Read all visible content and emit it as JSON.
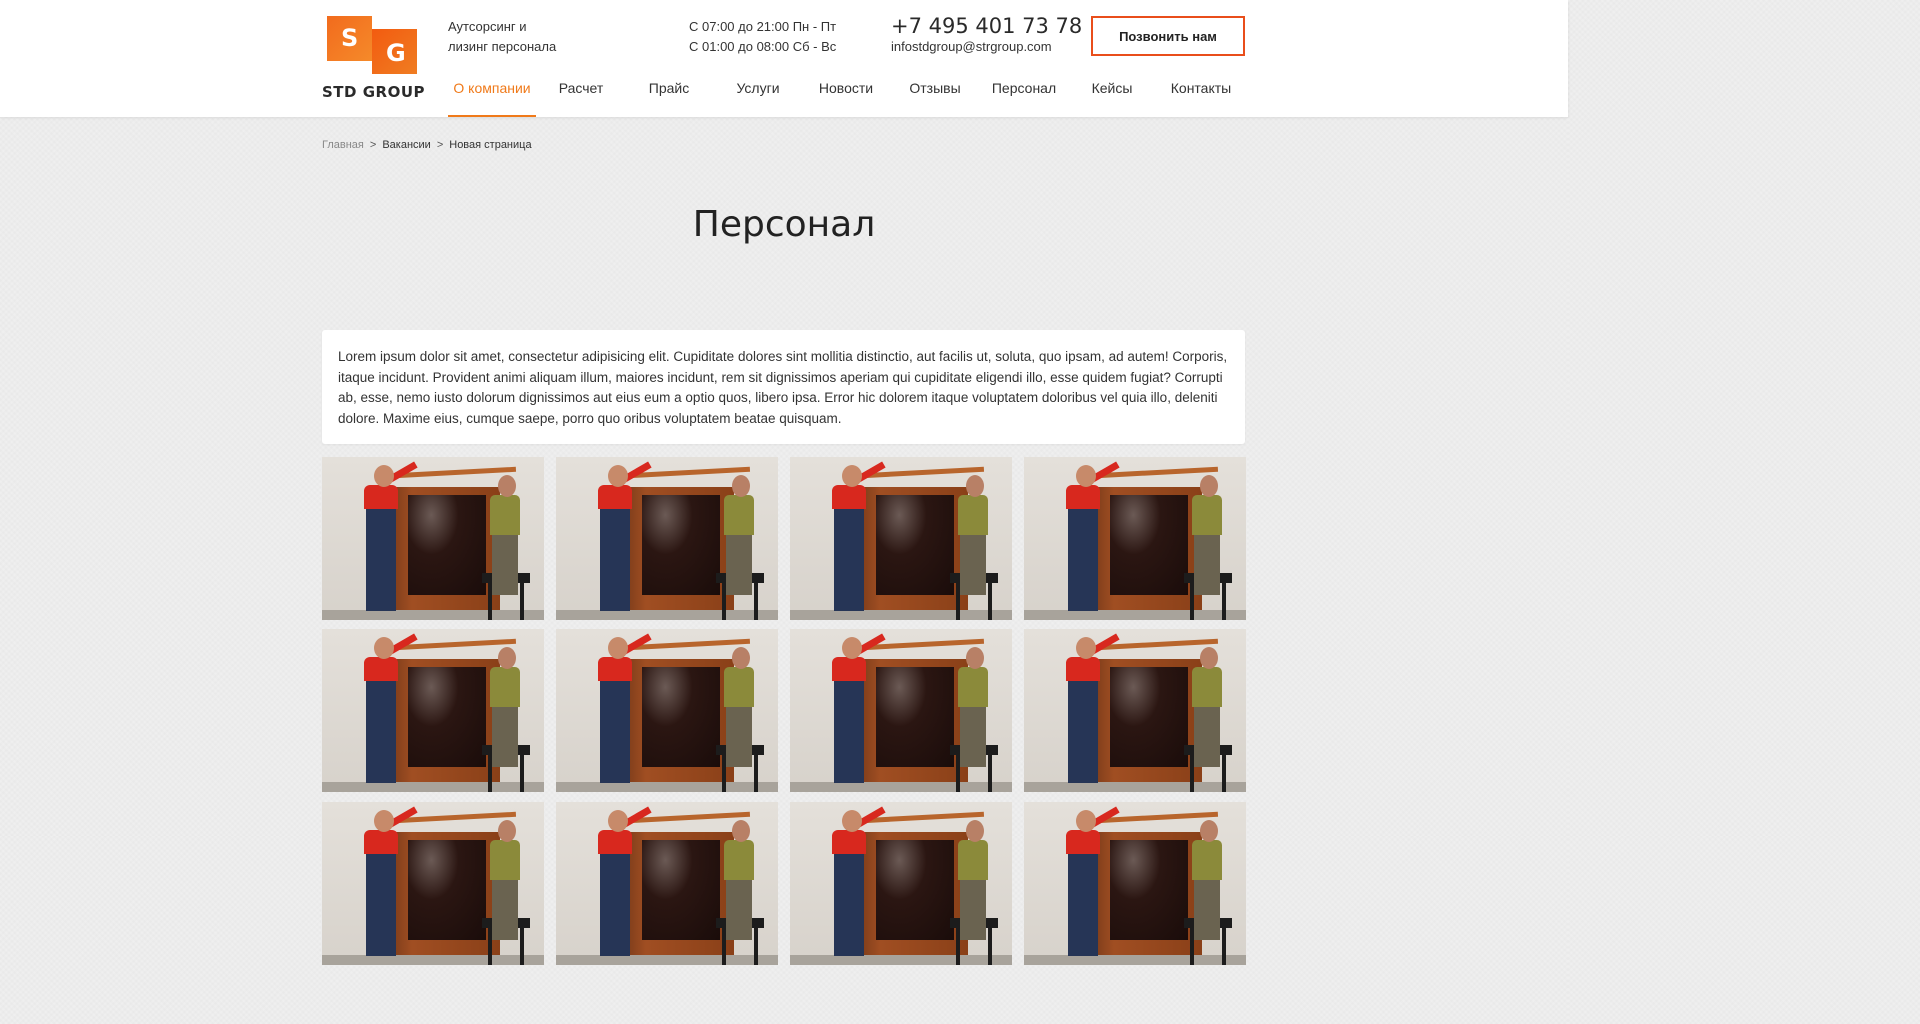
{
  "logo": {
    "letter1": "S",
    "letter2": "G",
    "name": "STD GROUP"
  },
  "tagline": {
    "line1": "Аутсорсинг и",
    "line2": "лизинг персонала"
  },
  "hours": {
    "line1": "С 07:00 до 21:00 Пн - Пт",
    "line2": "С 01:00 до 08:00 Сб - Вс"
  },
  "contact": {
    "phone": "+7 495 401 73 78",
    "email": "infostdgroup@strgroup.com"
  },
  "call_button": "Позвонить нам",
  "nav": {
    "items": [
      {
        "label": "О компании",
        "active": true
      },
      {
        "label": "Расчет",
        "active": false
      },
      {
        "label": "Прайс",
        "active": false
      },
      {
        "label": "Услуги",
        "active": false
      },
      {
        "label": "Новости",
        "active": false
      },
      {
        "label": "Отзывы",
        "active": false
      },
      {
        "label": "Персонал",
        "active": false
      },
      {
        "label": "Кейсы",
        "active": false
      },
      {
        "label": "Контакты",
        "active": false
      }
    ]
  },
  "breadcrumb": {
    "items": [
      "Главная",
      "Вакансии",
      "Новая страница"
    ],
    "separator": ">"
  },
  "page_title": "Персонал",
  "intro_text": "Lorem ipsum dolor sit amet, consectetur adipisicing elit. Cupiditate dolores sint mollitia distinctio, aut facilis ut, soluta, quo ipsam, ad autem! Corporis, itaque incidunt. Provident animi aliquam illum, maiores incidunt, rem sit dignissimos aperiam qui cupiditate eligendi illo, esse quidem fugiat? Corrupti ab, esse, nemo iusto dolorum dignissimos aut eius eum a optio quos, libero ipsa. Error hic dolorem itaque voluptatem doloribus vel quia illo, deleniti dolore. Maxime eius, cumque saepe, porro quo oribus voluptatem beatae quisquam.",
  "gallery": {
    "photo_count": 12,
    "photo_subject": "workers-installing-cabinet"
  },
  "colors": {
    "accent": "#f07a1a",
    "button_border": "#e94e1b",
    "logo_orange": "#f26b1d"
  }
}
